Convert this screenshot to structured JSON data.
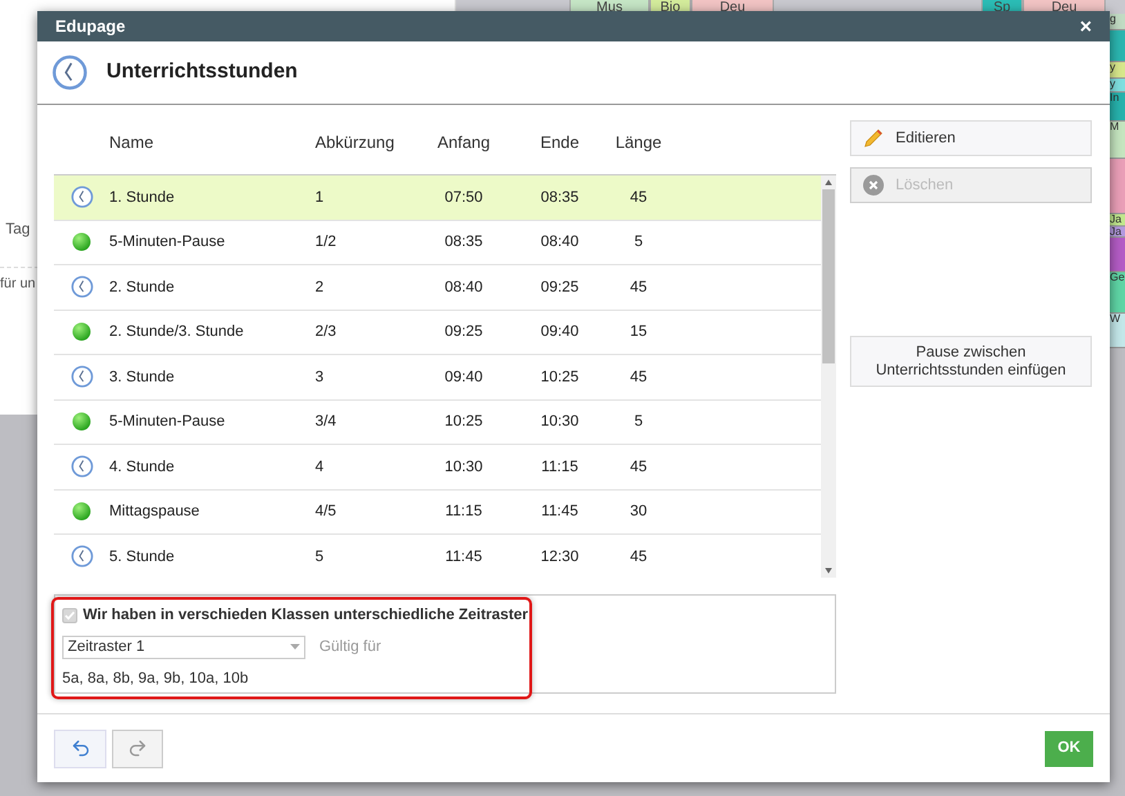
{
  "background": {
    "left_texts": [
      "Tag",
      "für un"
    ],
    "top_cells": [
      {
        "label": "Mus",
        "color": "#c6e6c6"
      },
      {
        "label": "Bio",
        "color": "#d4ec9c"
      },
      {
        "label": "Deu",
        "color": "#f2c4c4"
      },
      {
        "label": "Sp",
        "color": "#2bbdb6"
      },
      {
        "label": "Deu",
        "color": "#f2c4c4"
      }
    ],
    "side_cells": [
      {
        "label": "g",
        "color": "#c2dcc4"
      },
      {
        "color": "#2bb6b0"
      },
      {
        "label": "y",
        "color": "#d8e88c"
      },
      {
        "label": "y",
        "color": "#7fe0e0"
      },
      {
        "label": "In",
        "color": "#27b3ad"
      },
      {
        "label": "M",
        "color": "#c6e6c0"
      },
      {
        "color": "#ea9fb8"
      },
      {
        "label": "Ja",
        "color": "#c2e88e"
      },
      {
        "label": "Ja",
        "color": "#b49ae0"
      },
      {
        "color": "#b45cc6"
      },
      {
        "label": "Ge",
        "color": "#5fd6a6"
      },
      {
        "label": "W",
        "color": "#c4e8ea"
      }
    ]
  },
  "window": {
    "title": "Edupage",
    "close": "×"
  },
  "header": {
    "title": "Unterrichtsstunden"
  },
  "table": {
    "columns": [
      "Name",
      "Abkürzung",
      "Anfang",
      "Ende",
      "Länge"
    ],
    "rows": [
      {
        "kind": "lesson",
        "selected": true,
        "cells": [
          "1. Stunde",
          "1",
          "07:50",
          "08:35",
          "45"
        ]
      },
      {
        "kind": "break",
        "selected": false,
        "cells": [
          "5-Minuten-Pause",
          "1/2",
          "08:35",
          "08:40",
          "5"
        ]
      },
      {
        "kind": "lesson",
        "selected": false,
        "cells": [
          "2. Stunde",
          "2",
          "08:40",
          "09:25",
          "45"
        ]
      },
      {
        "kind": "break",
        "selected": false,
        "cells": [
          "2. Stunde/3. Stunde",
          "2/3",
          "09:25",
          "09:40",
          "15"
        ]
      },
      {
        "kind": "lesson",
        "selected": false,
        "cells": [
          "3. Stunde",
          "3",
          "09:40",
          "10:25",
          "45"
        ]
      },
      {
        "kind": "break",
        "selected": false,
        "cells": [
          "5-Minuten-Pause",
          "3/4",
          "10:25",
          "10:30",
          "5"
        ]
      },
      {
        "kind": "lesson",
        "selected": false,
        "cells": [
          "4. Stunde",
          "4",
          "10:30",
          "11:15",
          "45"
        ]
      },
      {
        "kind": "break",
        "selected": false,
        "cells": [
          "Mittagspause",
          "4/5",
          "11:15",
          "11:45",
          "30"
        ]
      },
      {
        "kind": "lesson",
        "selected": false,
        "cells": [
          "5. Stunde",
          "5",
          "11:45",
          "12:30",
          "45"
        ]
      }
    ]
  },
  "actions": [
    {
      "kind": "edit",
      "label": "Editieren",
      "disabled": false
    },
    {
      "kind": "delete",
      "label": "Löschen",
      "disabled": true
    }
  ],
  "insert_break_button": "Pause zwischen Unterrichtsstunden einfügen",
  "timetables": {
    "checkbox": {
      "label": "Wir haben in verschieden Klassen unterschiedliche Zeitraster",
      "checked": true,
      "disabled": true
    },
    "select": "Zeitraster 1",
    "valid_for": "Gültig für",
    "classes": "5a, 8a, 8b, 9a, 9b, 10a, 10b"
  },
  "footer": {
    "ok": "OK"
  }
}
